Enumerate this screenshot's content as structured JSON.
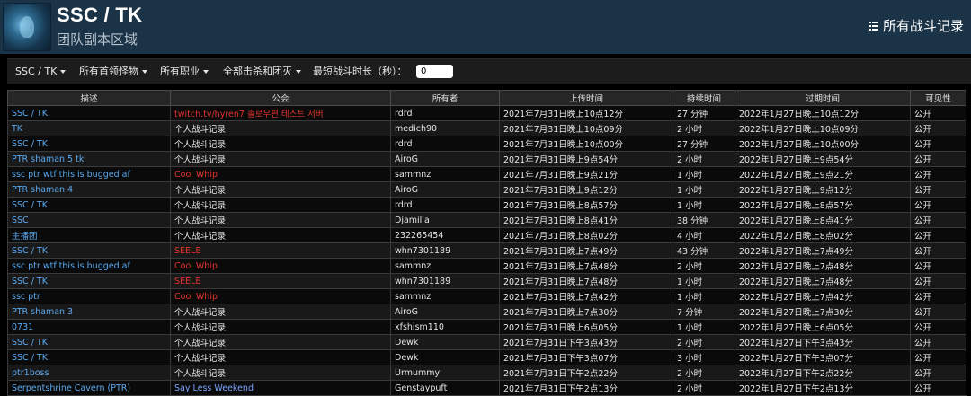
{
  "header": {
    "title": "SSC / TK",
    "subtitle": "团队副本区域",
    "all_records_label": "所有战斗记录",
    "all_records_icon": "list-icon"
  },
  "filters": {
    "zone": "SSC / TK",
    "bosses": "所有首领怪物",
    "classes": "所有职业",
    "kills": "全部击杀和团灭",
    "min_duration_label": "最短战斗时长（秒）：",
    "min_duration_value": "0"
  },
  "table": {
    "columns": [
      "描述",
      "公会",
      "所有者",
      "上传时间",
      "持续时间",
      "过期时间",
      "可见性"
    ],
    "rows": [
      {
        "desc": "SSC / TK",
        "guild": "twitch.tv/hyren7 솔로우편 테스트 서버",
        "guild_style": "red",
        "owner": "rdrd",
        "uploaded": "2021年7月31日晚上10点12分",
        "duration": "27 分钟",
        "expires": "2022年1月27日晚上10点12分",
        "visibility": "公开"
      },
      {
        "desc": "TK",
        "guild": "个人战斗记录",
        "guild_style": "plain",
        "owner": "medich90",
        "uploaded": "2021年7月31日晚上10点09分",
        "duration": "2 小时",
        "expires": "2022年1月27日晚上10点09分",
        "visibility": "公开"
      },
      {
        "desc": "SSC / TK",
        "guild": "个人战斗记录",
        "guild_style": "plain",
        "owner": "rdrd",
        "uploaded": "2021年7月31日晚上10点00分",
        "duration": "27 分钟",
        "expires": "2022年1月27日晚上10点00分",
        "visibility": "公开"
      },
      {
        "desc": "PTR shaman 5 tk",
        "guild": "个人战斗记录",
        "guild_style": "plain",
        "owner": "AiroG",
        "uploaded": "2021年7月31日晚上9点54分",
        "duration": "2 小时",
        "expires": "2022年1月27日晚上9点54分",
        "visibility": "公开"
      },
      {
        "desc": "ssc ptr wtf this is bugged af",
        "guild": "Cool Whip",
        "guild_style": "red",
        "owner": "sammnz",
        "uploaded": "2021年7月31日晚上9点21分",
        "duration": "1 小时",
        "expires": "2022年1月27日晚上9点21分",
        "visibility": "公开"
      },
      {
        "desc": "PTR shaman 4",
        "guild": "个人战斗记录",
        "guild_style": "plain",
        "owner": "AiroG",
        "uploaded": "2021年7月31日晚上9点12分",
        "duration": "1 小时",
        "expires": "2022年1月27日晚上9点12分",
        "visibility": "公开"
      },
      {
        "desc": "SSC / TK",
        "guild": "个人战斗记录",
        "guild_style": "plain",
        "owner": "rdrd",
        "uploaded": "2021年7月31日晚上8点57分",
        "duration": "1 小时",
        "expires": "2022年1月27日晚上8点57分",
        "visibility": "公开"
      },
      {
        "desc": "SSC",
        "guild": "个人战斗记录",
        "guild_style": "plain",
        "owner": "Djamilla",
        "uploaded": "2021年7月31日晚上8点41分",
        "duration": "38 分钟",
        "expires": "2022年1月27日晚上8点41分",
        "visibility": "公开"
      },
      {
        "desc": "主播团",
        "guild": "个人战斗记录",
        "guild_style": "plain",
        "owner": "232265454",
        "uploaded": "2021年7月31日晚上8点02分",
        "duration": "4 小时",
        "expires": "2022年1月27日晚上8点02分",
        "visibility": "公开"
      },
      {
        "desc": "SSC / TK",
        "guild": "SEELE",
        "guild_style": "red",
        "owner": "whn7301189",
        "uploaded": "2021年7月31日晚上7点49分",
        "duration": "43 分钟",
        "expires": "2022年1月27日晚上7点49分",
        "visibility": "公开"
      },
      {
        "desc": "ssc ptr wtf this is bugged af",
        "guild": "Cool Whip",
        "guild_style": "red",
        "owner": "sammnz",
        "uploaded": "2021年7月31日晚上7点48分",
        "duration": "2 小时",
        "expires": "2022年1月27日晚上7点48分",
        "visibility": "公开"
      },
      {
        "desc": "SSC / TK",
        "guild": "SEELE",
        "guild_style": "red",
        "owner": "whn7301189",
        "uploaded": "2021年7月31日晚上7点48分",
        "duration": "1 小时",
        "expires": "2022年1月27日晚上7点48分",
        "visibility": "公开"
      },
      {
        "desc": "ssc ptr",
        "guild": "Cool Whip",
        "guild_style": "red",
        "owner": "sammnz",
        "uploaded": "2021年7月31日晚上7点42分",
        "duration": "1 小时",
        "expires": "2022年1月27日晚上7点42分",
        "visibility": "公开"
      },
      {
        "desc": "PTR shaman 3",
        "guild": "个人战斗记录",
        "guild_style": "plain",
        "owner": "AiroG",
        "uploaded": "2021年7月31日晚上7点30分",
        "duration": "7 分钟",
        "expires": "2022年1月27日晚上7点30分",
        "visibility": "公开"
      },
      {
        "desc": "0731",
        "guild": "个人战斗记录",
        "guild_style": "plain",
        "owner": "xfshism110",
        "uploaded": "2021年7月31日晚上6点05分",
        "duration": "1 小时",
        "expires": "2022年1月27日晚上6点05分",
        "visibility": "公开"
      },
      {
        "desc": "SSC / TK",
        "guild": "个人战斗记录",
        "guild_style": "plain",
        "owner": "Dewk",
        "uploaded": "2021年7月31日下午3点43分",
        "duration": "2 小时",
        "expires": "2022年1月27日下午3点43分",
        "visibility": "公开"
      },
      {
        "desc": "SSC / TK",
        "guild": "个人战斗记录",
        "guild_style": "plain",
        "owner": "Dewk",
        "uploaded": "2021年7月31日下午3点07分",
        "duration": "3 小时",
        "expires": "2022年1月27日下午3点07分",
        "visibility": "公开"
      },
      {
        "desc": "ptr1boss",
        "guild": "个人战斗记录",
        "guild_style": "plain",
        "owner": "Urmummy",
        "uploaded": "2021年7月31日下午2点22分",
        "duration": "2 小时",
        "expires": "2022年1月27日下午2点22分",
        "visibility": "公开"
      },
      {
        "desc": "Serpentshrine Cavern (PTR)",
        "guild": "Say Less Weekend",
        "guild_style": "blue",
        "owner": "Genstaypuft",
        "uploaded": "2021年7月31日下午2点13分",
        "duration": "2 小时",
        "expires": "2022年1月27日下午2点13分",
        "visibility": "公开"
      }
    ]
  }
}
